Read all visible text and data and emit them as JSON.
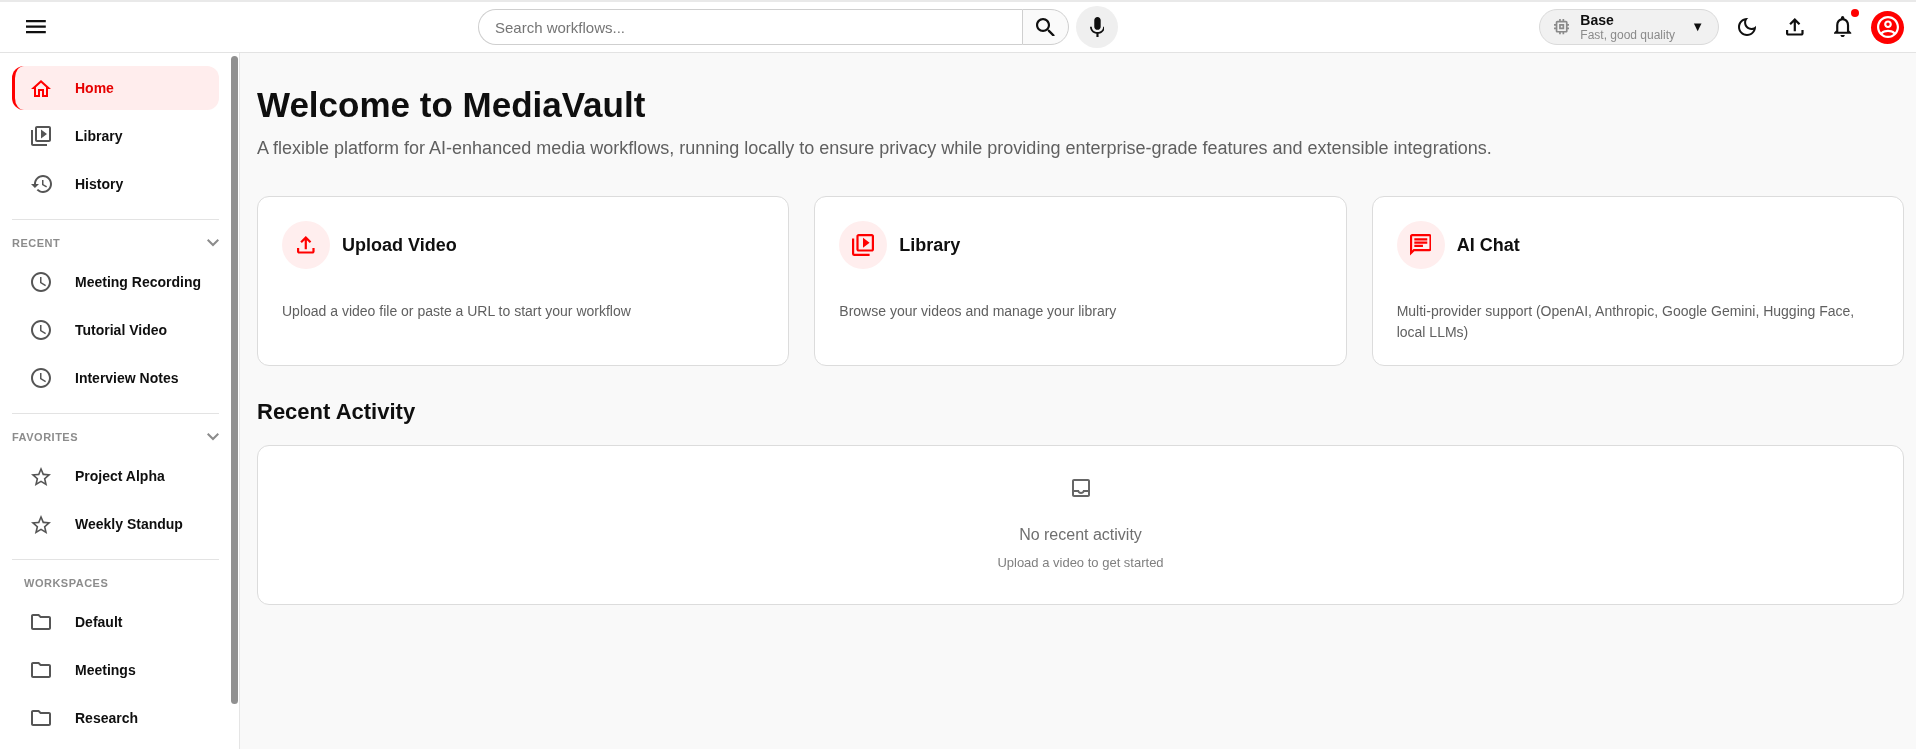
{
  "topbar": {
    "search": {
      "placeholder": "Search workflows..."
    },
    "model_selector": {
      "name": "Base",
      "description": "Fast, good quality",
      "caret": "▼"
    },
    "notifications": {
      "unread": true
    }
  },
  "sidebar": {
    "nav": [
      {
        "kind": "home",
        "label": "Home",
        "selected": true
      },
      {
        "kind": "library",
        "label": "Library",
        "selected": false
      },
      {
        "kind": "history",
        "label": "History",
        "selected": false
      }
    ],
    "sections": [
      {
        "kind": "recent",
        "title": "RECENT",
        "expanded": true,
        "items": [
          {
            "label": "Meeting Recording",
            "selected": false
          },
          {
            "label": "Tutorial Video",
            "selected": false
          },
          {
            "label": "Interview Notes",
            "selected": false
          }
        ]
      },
      {
        "kind": "favorites",
        "title": "FAVORITES",
        "expanded": true,
        "items": [
          {
            "label": "Project Alpha",
            "selected": false
          },
          {
            "label": "Weekly Standup",
            "selected": false
          }
        ]
      },
      {
        "kind": "workspaces",
        "title": "WORKSPACES",
        "items": [
          {
            "label": "Default",
            "selected": false
          },
          {
            "label": "Meetings",
            "selected": false
          },
          {
            "label": "Research",
            "selected": false
          }
        ]
      }
    ]
  },
  "main": {
    "title": "Welcome to MediaVault",
    "subtitle": "A flexible platform for AI-enhanced media workflows, running locally to ensure privacy while providing enterprise-grade features and extensible integrations.",
    "cards": [
      {
        "kind": "upload",
        "title": "Upload Video",
        "description": "Upload a video file or paste a URL to start your workflow"
      },
      {
        "kind": "library",
        "title": "Library",
        "description": "Browse your videos and manage your library"
      },
      {
        "kind": "chat",
        "title": "AI Chat",
        "description": "Multi-provider support (OpenAI, Anthropic, Google Gemini, Hugging Face, local LLMs)"
      }
    ],
    "recent_activity": {
      "title": "Recent Activity",
      "empty_message": "No recent activity",
      "empty_hint": "Upload a video to get started"
    }
  }
}
